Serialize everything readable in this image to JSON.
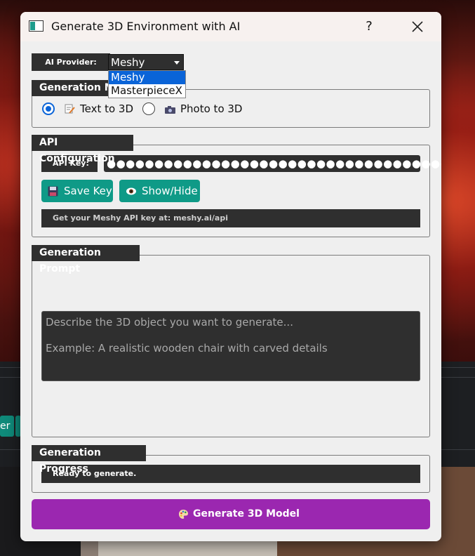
{
  "window": {
    "title": "Generate 3D Environment with AI",
    "help_label": "?"
  },
  "provider": {
    "label": "AI Provider:",
    "selected": "Meshy",
    "options": [
      "Meshy",
      "MasterpieceX"
    ]
  },
  "generation_mode": {
    "title": "Generation Mode",
    "title_visible": "Generation Mo",
    "options": [
      {
        "label": "Text to 3D",
        "icon": "pencil-paper-icon",
        "checked": true
      },
      {
        "label": "Photo to 3D",
        "icon": "camera-icon",
        "checked": false
      }
    ]
  },
  "api_config": {
    "title": "API Configuration",
    "key_label": "API Key:",
    "key_value": "●●●●●●●●●●●●●●●●●●●●●●●●●●●●●●●●●●●●●●●",
    "save_label": "Save Key",
    "show_hide_label": "Show/Hide",
    "info_text": "Get your Meshy API key at: meshy.ai/api"
  },
  "prompt": {
    "title": "Generation Prompt",
    "placeholder_line1": "Describe the 3D object you want to generate...",
    "placeholder_line2": "Example: A realistic wooden chair with carved details"
  },
  "progress": {
    "title": "Generation Progress",
    "status": "Ready to generate."
  },
  "generate_button": {
    "label": "Generate 3D Model",
    "icon": "palette-icon"
  },
  "background": {
    "partial_button_text": "er"
  },
  "colors": {
    "accent_blue": "#0a64d8",
    "teal": "#0f9a87",
    "purple": "#9b27b0",
    "dark_field": "#2f2f2f"
  }
}
